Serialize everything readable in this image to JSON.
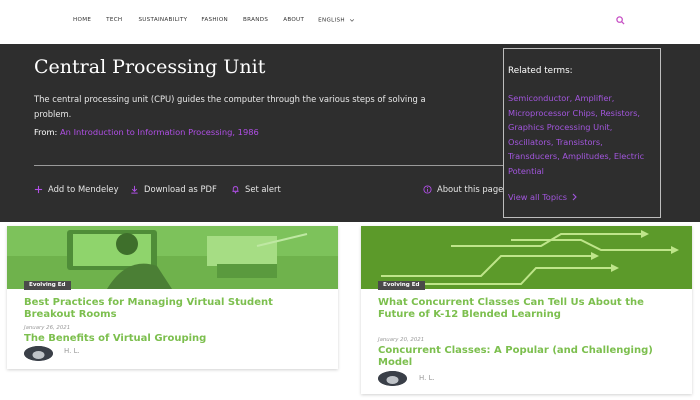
{
  "nav": {
    "links": [
      "HOME",
      "TECH",
      "SUSTAINABILITY",
      "FASHION",
      "BRANDS",
      "ABOUT",
      "ENGLISH"
    ],
    "search_icon": "search-icon",
    "colors": {
      "search": "#c64fc4"
    }
  },
  "topic": {
    "title": "Central Processing Unit",
    "description": "The central processing unit (CPU) guides the computer through the various steps of solving a problem.",
    "from_label": "From:",
    "from_source": "An Introduction to Information Processing, 1986",
    "actions": {
      "mendeley": "Add to Mendeley",
      "pdf": "Download as PDF",
      "alert": "Set alert",
      "about": "About this page"
    }
  },
  "related": {
    "title": "Related terms:",
    "terms": "Semiconductor, Amplifier, Microprocessor Chips, Resistors, Graphics Processing Unit, Oscillators, Transistors, Transducers, Amplitudes, Electric Potential",
    "view_all": "View all Topics"
  },
  "cards": [
    {
      "tag": "Evolving Ed",
      "title": "Best Practices for Managing Virtual Student Breakout Rooms",
      "date": "January 26, 2021",
      "subtitle": "The Benefits of Virtual Grouping",
      "author": "H. L."
    },
    {
      "tag": "Evolving Ed",
      "title": "What Concurrent Classes Can Tell Us About the Future of K-12 Blended Learning",
      "date": "January 20, 2021",
      "subtitle": "Concurrent Classes: A Popular (and Challenging) Model",
      "author": "H. L."
    }
  ],
  "colors": {
    "band": "#2e2e2e",
    "link_purple": "#a256dd",
    "card_green": "#7cbf4e"
  }
}
